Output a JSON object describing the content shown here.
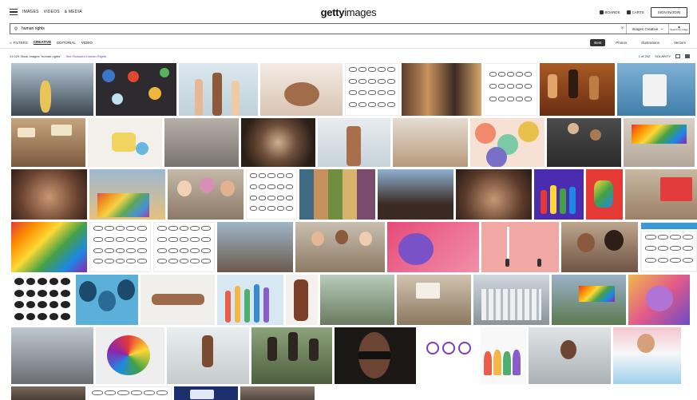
{
  "topnav": {
    "links": [
      "IMAGES",
      "VIDEOS",
      "& MEDIA"
    ],
    "logo_bold": "getty",
    "logo_light": "images",
    "boards_label": "BOARDS",
    "cart_label": "CARTS",
    "signin_label": "SIGN IN/JOIN"
  },
  "search": {
    "value": "human rights",
    "scope_label": "Images Creative",
    "image_search_label": "Search by image"
  },
  "filters": {
    "filters_label": "FILTERS",
    "tabs": [
      "CREATIVE",
      "EDITORIAL",
      "VIDEO"
    ],
    "sort_options": [
      "Best",
      "Photos",
      "Illustrations",
      "Vectors"
    ]
  },
  "results": {
    "count_text": "41,029 Stock Images “human rights”",
    "related_text": "See Featured Human Rights",
    "per_page": "1 of 202",
    "sort_view": "SOLARITY"
  },
  "colors": {
    "accent": "#6a3fc6",
    "primary_text": "#222222"
  }
}
